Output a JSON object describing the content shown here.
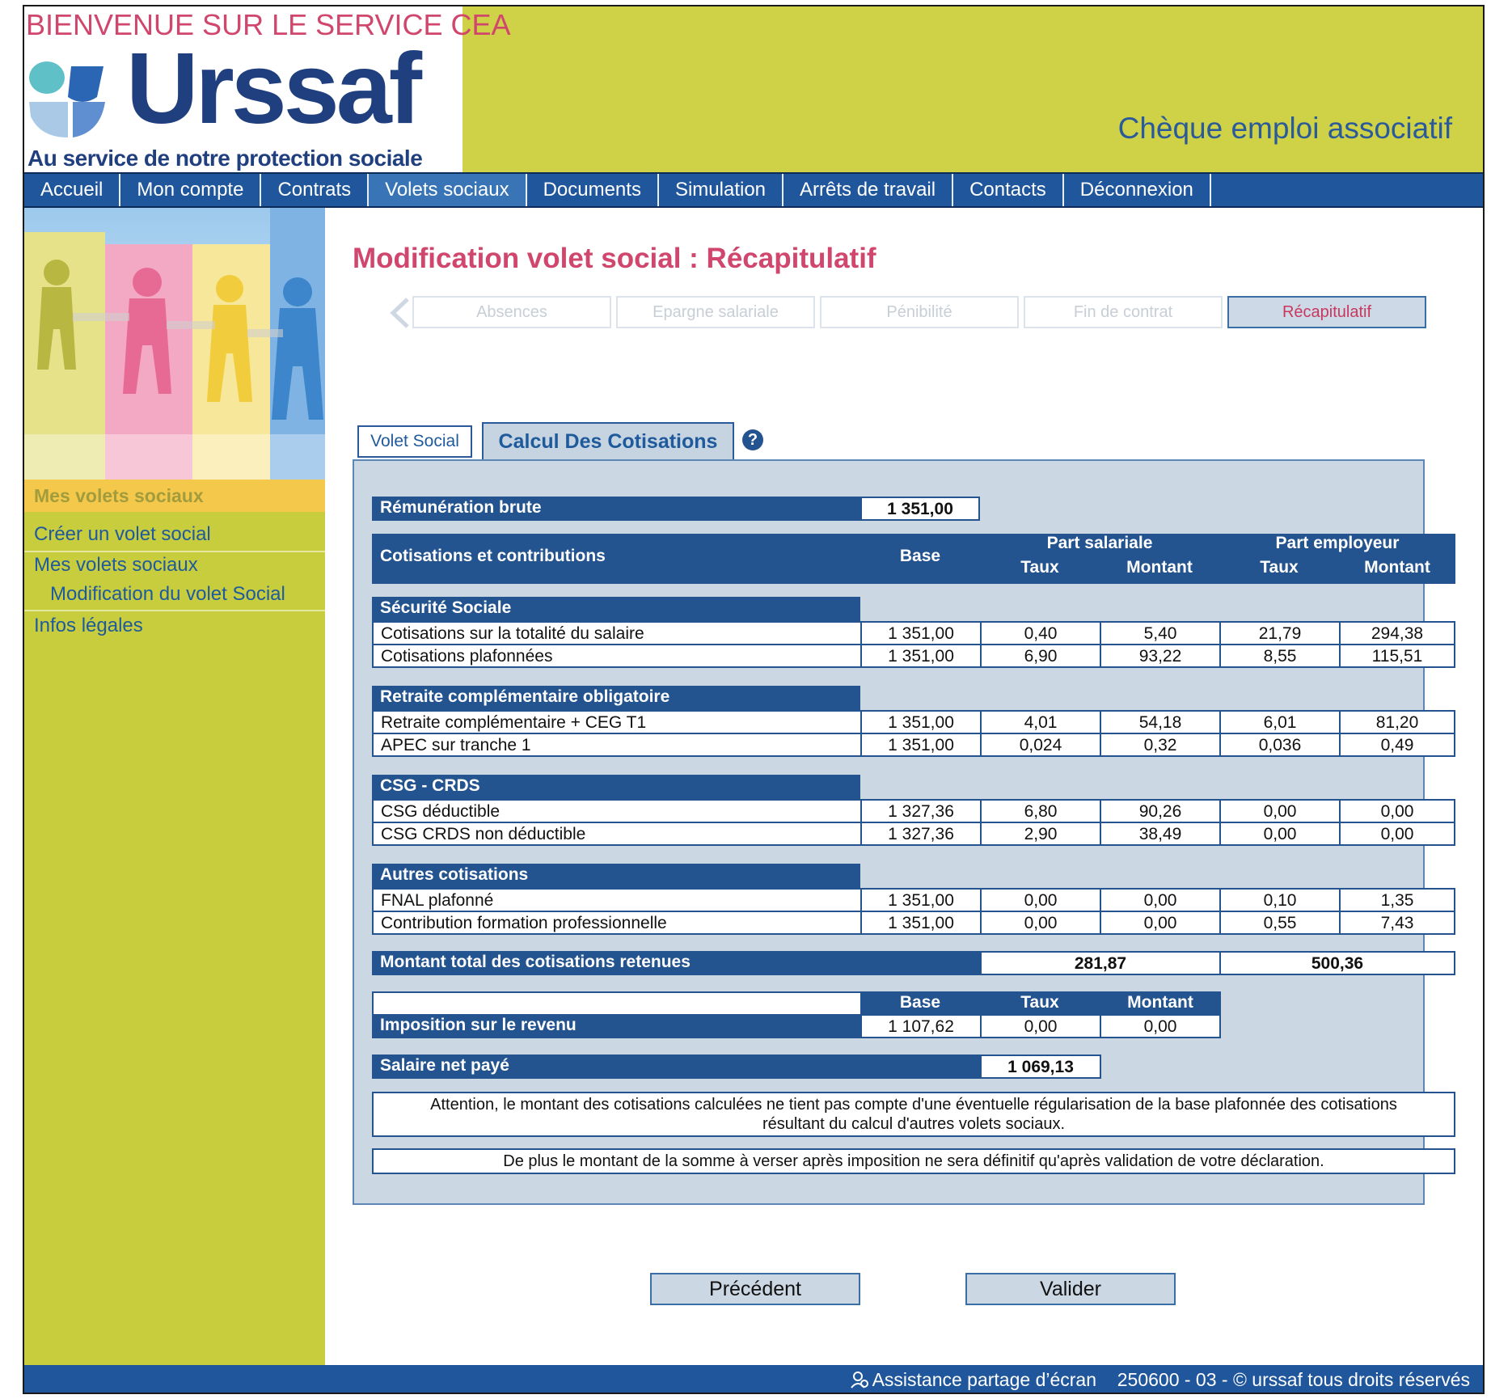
{
  "header": {
    "welcome": "BIENVENUE SUR LE SERVICE CEA",
    "logo_word": "Urssaf",
    "logo_tagline": "Au service de notre protection sociale",
    "product": "Chèque emploi associatif"
  },
  "nav": {
    "items": [
      {
        "label": "Accueil"
      },
      {
        "label": "Mon compte"
      },
      {
        "label": "Contrats"
      },
      {
        "label": "Volets sociaux"
      },
      {
        "label": "Documents"
      },
      {
        "label": "Simulation"
      },
      {
        "label": "Arrêts de travail"
      },
      {
        "label": "Contacts"
      },
      {
        "label": "Déconnexion"
      }
    ],
    "active": "Volets sociaux"
  },
  "sidebar": {
    "heading": "Mes volets sociaux",
    "links": [
      {
        "label": "Créer un volet social"
      },
      {
        "label": "Mes volets sociaux"
      },
      {
        "label": "Modification du volet Social"
      },
      {
        "label": "Infos légales"
      }
    ]
  },
  "main": {
    "title": "Modification volet social : Récapitulatif",
    "steps": [
      {
        "label": "Absences"
      },
      {
        "label": "Epargne salariale"
      },
      {
        "label": "Pénibilité"
      },
      {
        "label": "Fin de contrat"
      },
      {
        "label": "Récapitulatif"
      }
    ],
    "tabs": {
      "volet": "Volet Social",
      "calcul": "Calcul Des Cotisations"
    },
    "help_icon": "?"
  },
  "calc": {
    "remuneration_label": "Rémunération brute",
    "remuneration_value": "1 351,00",
    "header": {
      "label": "Cotisations et contributions",
      "base": "Base",
      "part_salariale": "Part salariale",
      "part_employeur": "Part employeur",
      "taux": "Taux",
      "montant": "Montant"
    },
    "sections": [
      {
        "title": "Sécurité Sociale",
        "rows": [
          {
            "label": "Cotisations sur la totalité du salaire",
            "base": "1 351,00",
            "taux_s": "0,40",
            "montant_s": "5,40",
            "taux_e": "21,79",
            "montant_e": "294,38"
          },
          {
            "label": "Cotisations plafonnées",
            "base": "1 351,00",
            "taux_s": "6,90",
            "montant_s": "93,22",
            "taux_e": "8,55",
            "montant_e": "115,51"
          }
        ]
      },
      {
        "title": "Retraite complémentaire obligatoire",
        "rows": [
          {
            "label": "Retraite complémentaire + CEG T1",
            "base": "1 351,00",
            "taux_s": "4,01",
            "montant_s": "54,18",
            "taux_e": "6,01",
            "montant_e": "81,20"
          },
          {
            "label": "APEC sur tranche 1",
            "base": "1 351,00",
            "taux_s": "0,024",
            "montant_s": "0,32",
            "taux_e": "0,036",
            "montant_e": "0,49"
          }
        ]
      },
      {
        "title": "CSG - CRDS",
        "rows": [
          {
            "label": "CSG déductible",
            "base": "1 327,36",
            "taux_s": "6,80",
            "montant_s": "90,26",
            "taux_e": "0,00",
            "montant_e": "0,00"
          },
          {
            "label": "CSG CRDS non déductible",
            "base": "1 327,36",
            "taux_s": "2,90",
            "montant_s": "38,49",
            "taux_e": "0,00",
            "montant_e": "0,00"
          }
        ]
      },
      {
        "title": "Autres cotisations",
        "rows": [
          {
            "label": "FNAL plafonné",
            "base": "1 351,00",
            "taux_s": "0,00",
            "montant_s": "0,00",
            "taux_e": "0,10",
            "montant_e": "1,35"
          },
          {
            "label": "Contribution formation professionnelle",
            "base": "1 351,00",
            "taux_s": "0,00",
            "montant_s": "0,00",
            "taux_e": "0,55",
            "montant_e": "7,43"
          }
        ]
      }
    ],
    "total": {
      "label": "Montant total des cotisations retenues",
      "salariale": "281,87",
      "employeur": "500,36"
    },
    "imposition": {
      "label": "Imposition sur le revenu",
      "base_h": "Base",
      "taux_h": "Taux",
      "montant_h": "Montant",
      "base": "1 107,62",
      "taux": "0,00",
      "montant": "0,00"
    },
    "net": {
      "label": "Salaire net payé",
      "value": "1 069,13"
    },
    "note1": "Attention, le montant des cotisations calculées ne tient pas compte d'une éventuelle régularisation de la base plafonnée des cotisations résultant du calcul d'autres volets sociaux.",
    "note2": "De plus le montant de la somme à verser après imposition ne sera définitif qu'après validation de votre déclaration."
  },
  "buttons": {
    "prev": "Précédent",
    "submit": "Valider"
  },
  "footer": {
    "assist": "Assistance partage d’écran",
    "copyright": "250600 - 03 - © urssaf tous droits réservés"
  },
  "colors": {
    "brand_blue": "#20569c",
    "accent_pink": "#d0466c",
    "header_yellow": "#cfd147",
    "panel": "#cbd7e3"
  }
}
